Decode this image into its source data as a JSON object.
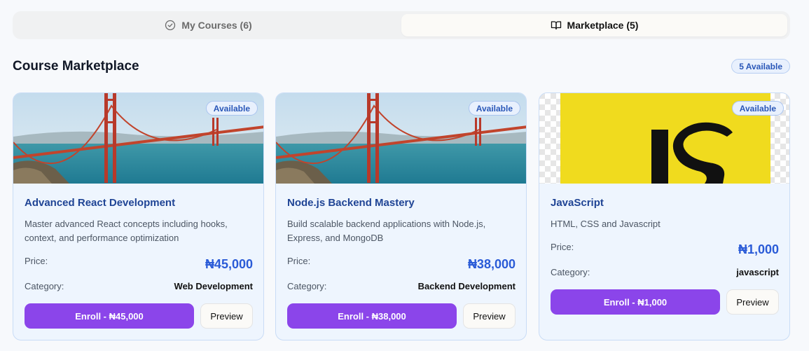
{
  "tabs": {
    "my_courses": "My Courses (6)",
    "marketplace": "Marketplace (5)"
  },
  "section": {
    "title": "Course Marketplace",
    "badge": "5 Available"
  },
  "labels": {
    "price": "Price:",
    "category": "Category:",
    "preview": "Preview",
    "available": "Available"
  },
  "courses": [
    {
      "title": "Advanced React Development",
      "description": "Master advanced React concepts including hooks, context, and performance optimization",
      "price": "₦45,000",
      "category": "Web Development",
      "enroll": "Enroll - ₦45,000",
      "image": "golden-gate-bridge"
    },
    {
      "title": "Node.js Backend Mastery",
      "description": "Build scalable backend applications with Node.js, Express, and MongoDB",
      "price": "₦38,000",
      "category": "Backend Development",
      "enroll": "Enroll - ₦38,000",
      "image": "golden-gate-bridge"
    },
    {
      "title": "JavaScript",
      "description": "HTML, CSS and Javascript",
      "price": "₦1,000",
      "category": "javascript",
      "enroll": "Enroll - ₦1,000",
      "image": "js-logo",
      "logo_text": "JS"
    }
  ],
  "colors": {
    "accent": "#8b45ea",
    "price": "#2a5bd7",
    "title": "#1f4495",
    "js_yellow": "#f0db1e"
  }
}
